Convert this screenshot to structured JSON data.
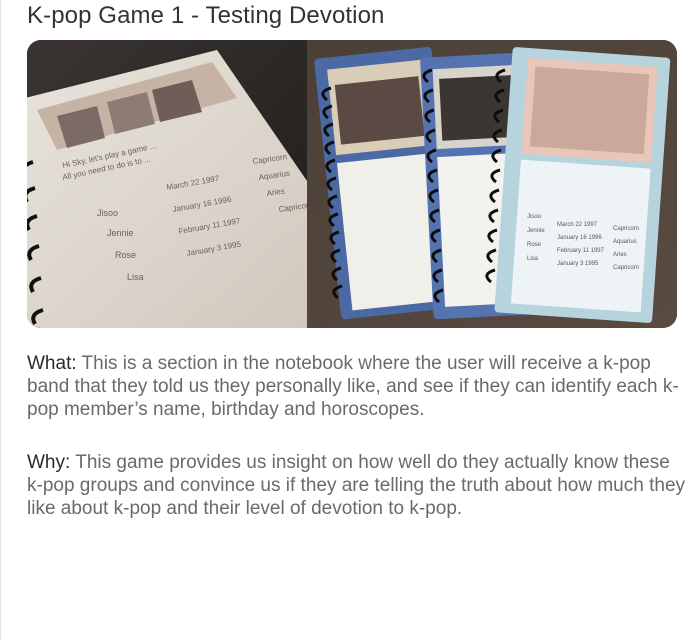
{
  "page": {
    "title": "K-pop Game 1 - Testing Devotion"
  },
  "photo": {
    "left_notebook": {
      "names": [
        "Jisoo",
        "Jennie",
        "Rose",
        "Lisa"
      ],
      "dates": [
        "March 22 1997",
        "January 16 1996",
        "February 11 1997",
        "January 3 1995"
      ],
      "signs": [
        "Capricorn",
        "Aquarius",
        "Aries",
        "Capricorn"
      ]
    },
    "right_notebook": {
      "names": [
        "Jisoo",
        "Jennie",
        "Rose",
        "Lisa"
      ],
      "dates": [
        "March 22 1997",
        "January 16 1996",
        "February 11 1997",
        "January 3 1995"
      ],
      "signs": [
        "Capricorn",
        "Aquarius",
        "Aries",
        "Capricorn"
      ]
    }
  },
  "what": {
    "label": "What:",
    "text": " This is a section in the notebook where the user will receive a k-pop band that they told us they personally like, and see if they can identify each k-pop member’s name, birthday and horoscopes."
  },
  "why": {
    "label": "Why:",
    "text": " This game provides us insight on how well do they actually know these k-pop groups and convince us if they are telling the truth about how much they like about k-pop and their level of devotion to k-pop."
  }
}
